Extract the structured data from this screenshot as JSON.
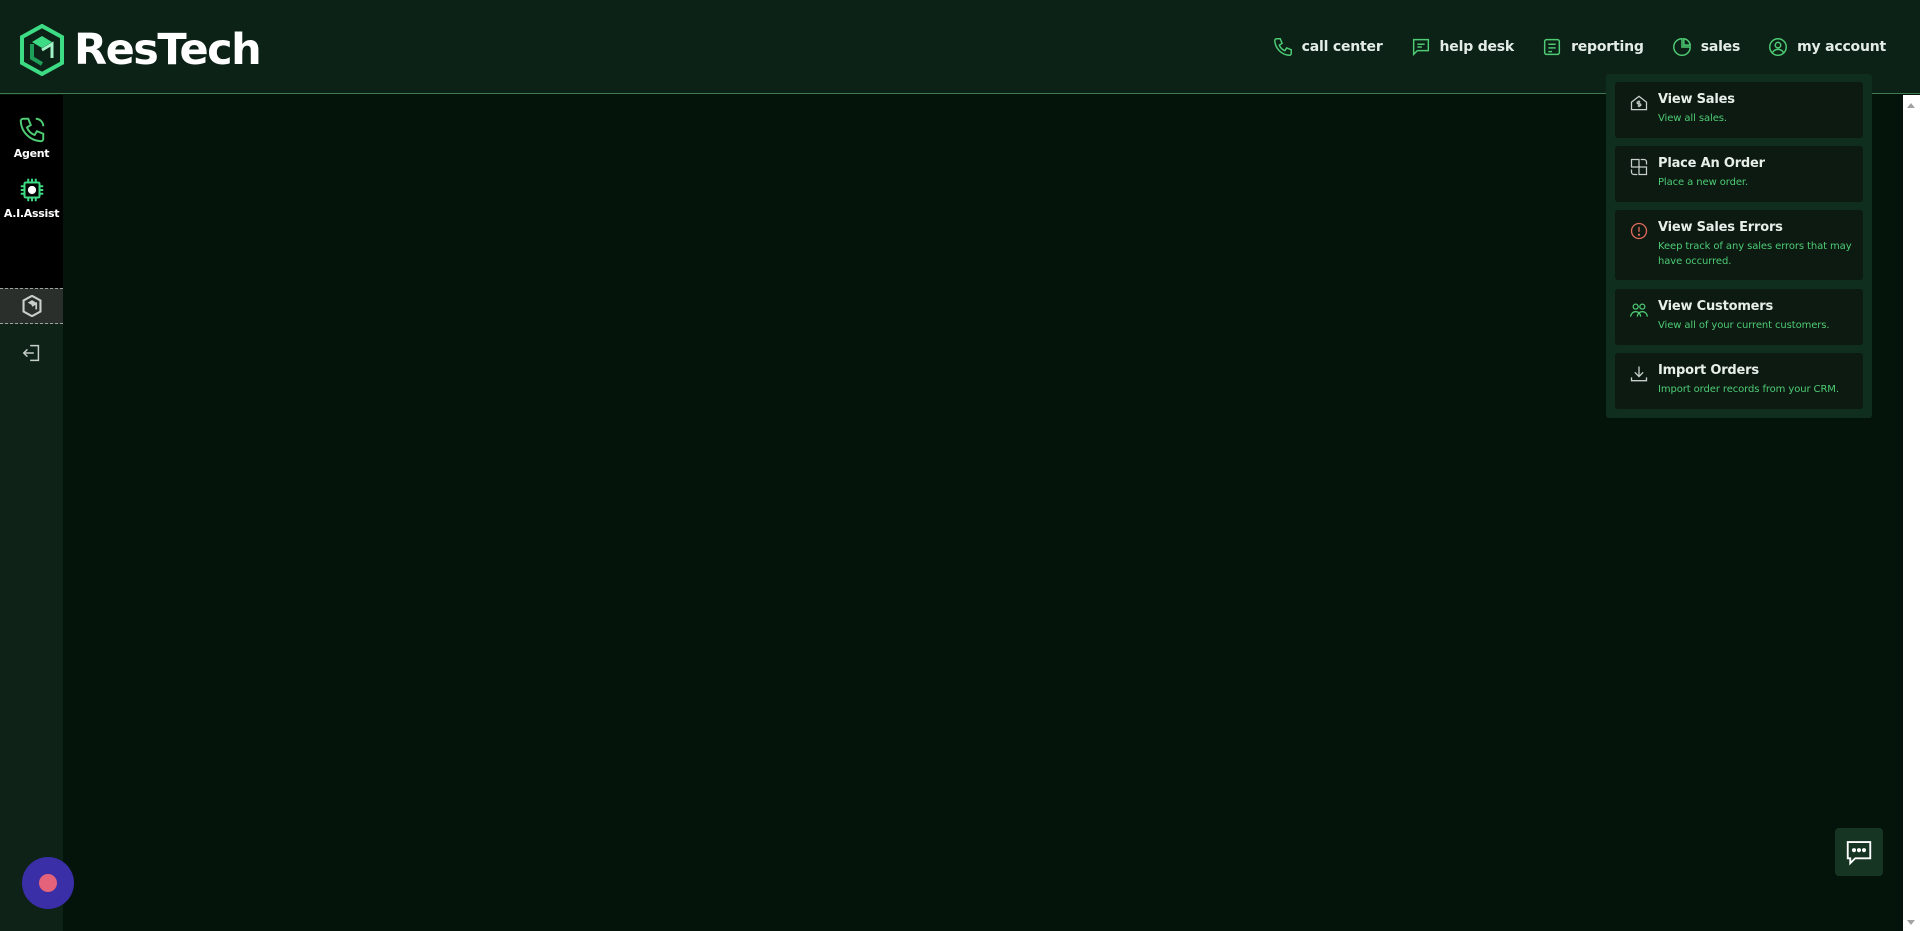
{
  "brand": {
    "name": "ResTech"
  },
  "nav": {
    "items": [
      {
        "label": "call center",
        "icon": "phone-icon"
      },
      {
        "label": "help desk",
        "icon": "message-square-icon"
      },
      {
        "label": "reporting",
        "icon": "report-icon"
      },
      {
        "label": "sales",
        "icon": "pie-chart-icon"
      },
      {
        "label": "my account",
        "icon": "user-circle-icon"
      }
    ]
  },
  "sidebar": {
    "items": [
      {
        "label": "Agent",
        "icon": "phone-icon"
      },
      {
        "label": "A.I.Assist",
        "icon": "chip-icon"
      }
    ],
    "widget_icon": "restech-logo-icon",
    "logout_icon": "logout-icon"
  },
  "sales_menu": {
    "items": [
      {
        "title": "View Sales",
        "description": "View all sales.",
        "icon": "house-dollar-icon"
      },
      {
        "title": "Place An Order",
        "description": "Place a new order.",
        "icon": "order-icon"
      },
      {
        "title": "View Sales Errors",
        "description": "Keep track of any sales errors that may have occurred.",
        "icon": "alert-circle-icon"
      },
      {
        "title": "View Customers",
        "description": "View all of your current customers.",
        "icon": "users-icon"
      },
      {
        "title": "Import Orders",
        "description": "Import order records from your CRM.",
        "icon": "download-icon"
      }
    ]
  },
  "colors": {
    "background": "#04140b",
    "header": "#0c2217",
    "accent": "#4ecb74",
    "error": "#e06a5a",
    "record": "#3a2fa6"
  }
}
